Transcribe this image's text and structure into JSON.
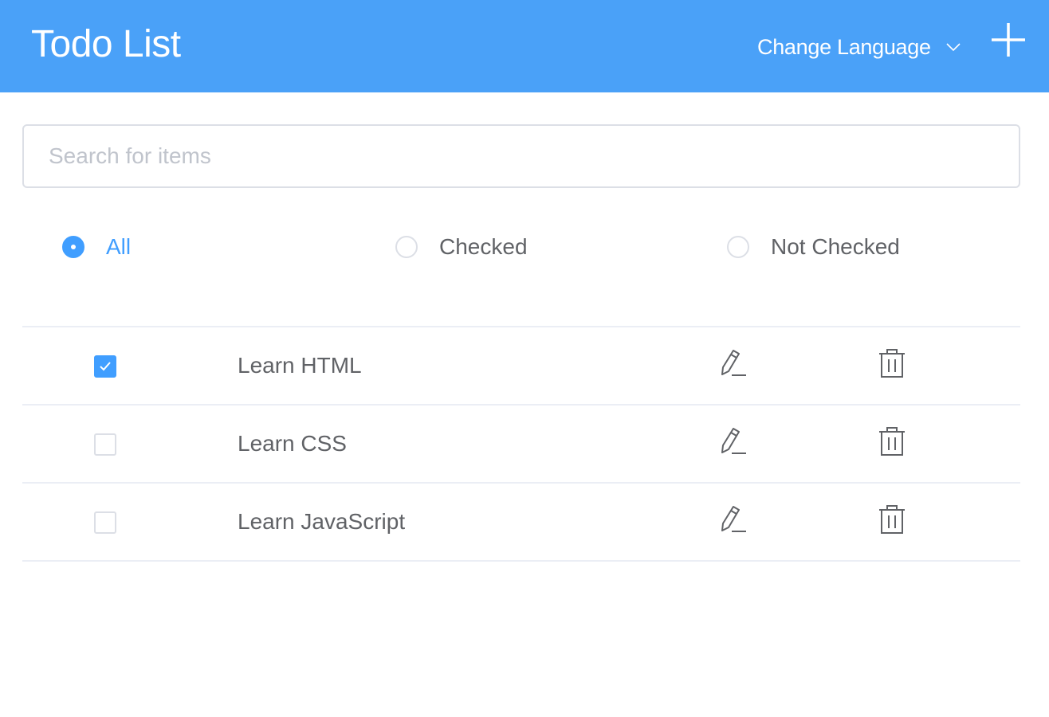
{
  "header": {
    "title": "Todo List",
    "language_label": "Change Language",
    "language_icon": "chevron-down-icon",
    "add_icon": "plus-icon",
    "background_color": "#4aa1f8"
  },
  "search": {
    "placeholder": "Search for items",
    "value": ""
  },
  "filters": {
    "options": [
      {
        "label": "All",
        "selected": true
      },
      {
        "label": "Checked",
        "selected": false
      },
      {
        "label": "Not Checked",
        "selected": false
      }
    ],
    "accent_color": "#409eff"
  },
  "todos": [
    {
      "text": "Learn HTML",
      "checked": true,
      "edit_icon": "pencil-icon",
      "delete_icon": "trash-icon"
    },
    {
      "text": "Learn CSS",
      "checked": false,
      "edit_icon": "pencil-icon",
      "delete_icon": "trash-icon"
    },
    {
      "text": "Learn JavaScript",
      "checked": false,
      "edit_icon": "pencil-icon",
      "delete_icon": "trash-icon"
    }
  ]
}
